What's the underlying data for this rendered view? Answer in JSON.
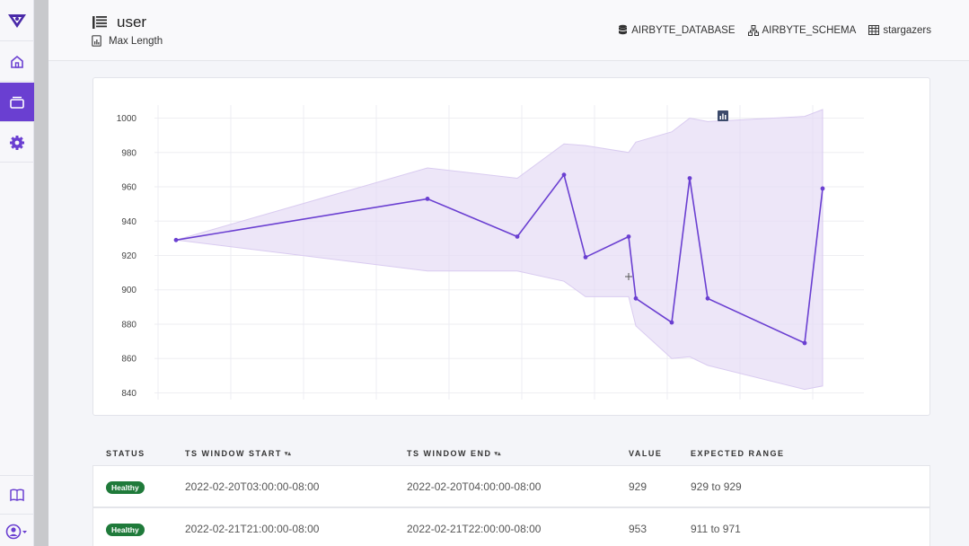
{
  "header": {
    "title": "user",
    "subtitle": "Max Length",
    "breadcrumbs": [
      {
        "icon": "database-icon",
        "label": "AIRBYTE_DATABASE"
      },
      {
        "icon": "schema-icon",
        "label": "AIRBYTE_SCHEMA"
      },
      {
        "icon": "table-icon",
        "label": "stargazers"
      }
    ]
  },
  "sidebar": {
    "items": [
      {
        "name": "logo",
        "icon": "logo-icon"
      },
      {
        "name": "home",
        "icon": "home-icon"
      },
      {
        "name": "datasets",
        "icon": "layers-icon",
        "active": true
      },
      {
        "name": "settings",
        "icon": "gear-icon"
      },
      {
        "name": "docs",
        "icon": "book-icon"
      },
      {
        "name": "account",
        "icon": "user-icon"
      }
    ]
  },
  "colors": {
    "accent": "#6a3fd1",
    "band": "#e6dcf5",
    "healthy": "#1f7a3a"
  },
  "chart_data": {
    "type": "line",
    "ylim": [
      835,
      1005
    ],
    "y_ticks": [
      840,
      860,
      880,
      900,
      920,
      940,
      960,
      980,
      1000
    ],
    "grid": true,
    "legend": "none",
    "series": [
      {
        "x": [
          0,
          7,
          9.5,
          10.8,
          11.4,
          12.6,
          12.8,
          13.8,
          14.3,
          14.8,
          17.5,
          18
        ],
        "values": [
          929,
          953,
          931,
          967,
          919,
          931,
          895,
          881,
          965,
          895,
          869,
          959
        ]
      }
    ],
    "band": {
      "x": [
        0,
        7,
        9.5,
        10.8,
        11.4,
        12.6,
        12.8,
        13.8,
        14.3,
        14.8,
        17.5,
        18
      ],
      "upper": [
        929,
        971,
        965,
        985,
        984,
        980,
        986,
        992,
        1000,
        998,
        1001,
        1005
      ],
      "lower": [
        929,
        911,
        911,
        905,
        896,
        896,
        879,
        860,
        861,
        856,
        842,
        844
      ]
    }
  },
  "table": {
    "columns": [
      {
        "label": "STATUS",
        "sortable": false
      },
      {
        "label": "TS WINDOW START",
        "sortable": true
      },
      {
        "label": "TS WINDOW END",
        "sortable": true
      },
      {
        "label": "VALUE",
        "sortable": false
      },
      {
        "label": "EXPECTED RANGE",
        "sortable": false
      }
    ],
    "rows": [
      {
        "status": "Healthy",
        "start": "2022-02-20T03:00:00-08:00",
        "end": "2022-02-20T04:00:00-08:00",
        "value": "929",
        "range": "929 to 929"
      },
      {
        "status": "Healthy",
        "start": "2022-02-21T21:00:00-08:00",
        "end": "2022-02-21T22:00:00-08:00",
        "value": "953",
        "range": "911 to 971"
      }
    ]
  }
}
